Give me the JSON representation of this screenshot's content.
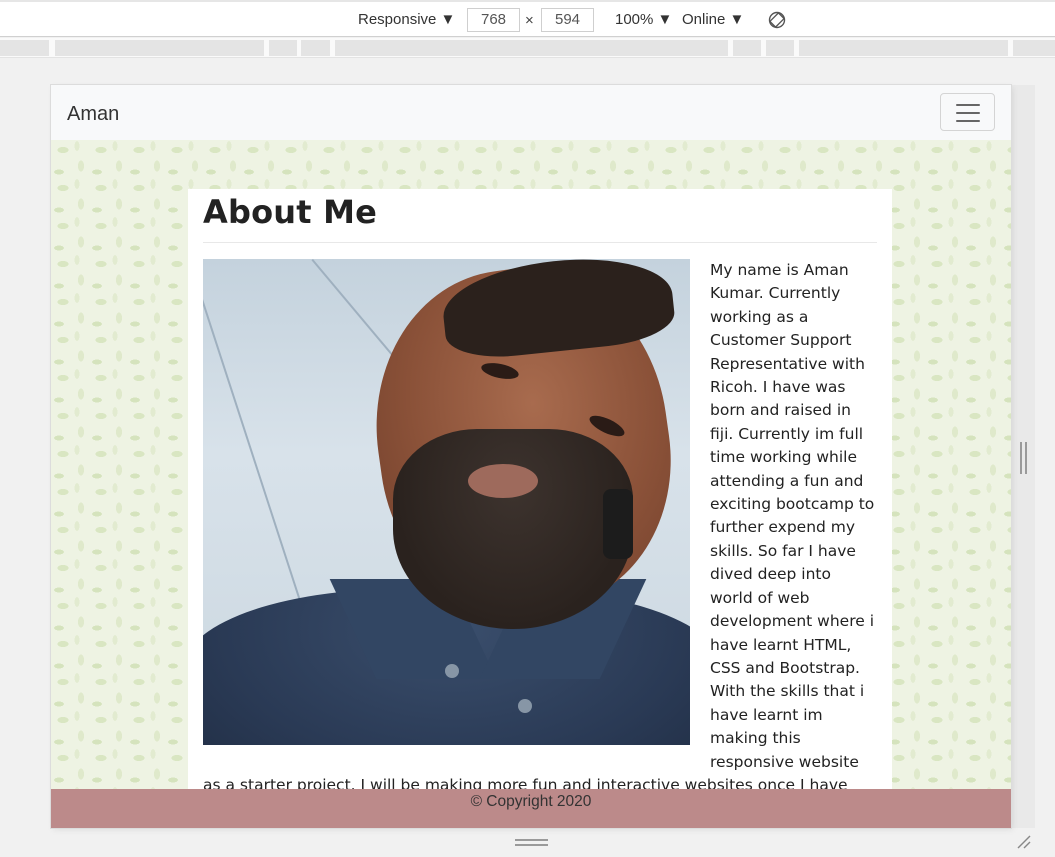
{
  "devtools": {
    "device_mode": "Responsive ▼",
    "width": "768",
    "times": "×",
    "height": "594",
    "zoom": "100% ▼",
    "network": "Online ▼",
    "rotate_icon": "rotate-icon"
  },
  "navbar": {
    "brand": "Aman",
    "toggler_icon": "hamburger-icon"
  },
  "about": {
    "title": "About Me",
    "photo_alt": "Profile photo",
    "bio": "My name is Aman Kumar. Currently working as a Customer Support Representative with Ricoh. I have was born and raised in fiji. Currently im full time working while attending a fun and exciting bootcamp to further expend my skills. So far I have dived deep into world of web development where i have learnt HTML, CSS and Bootstrap. With the skills that i have learnt im making this responsive website as a starter project. I will be making more fun and interactive websites once I have learnt more skills.During my spare time, I really enjoy playing video games, watching movies, reading books,listening to music, making lego and more.I enjoy"
  },
  "footer": {
    "copyright": "© Copyright 2020"
  },
  "colors": {
    "navbar_bg": "#f8f9fa",
    "footer_bg": "#bc8a8a",
    "pattern": "#d9e6c2"
  }
}
